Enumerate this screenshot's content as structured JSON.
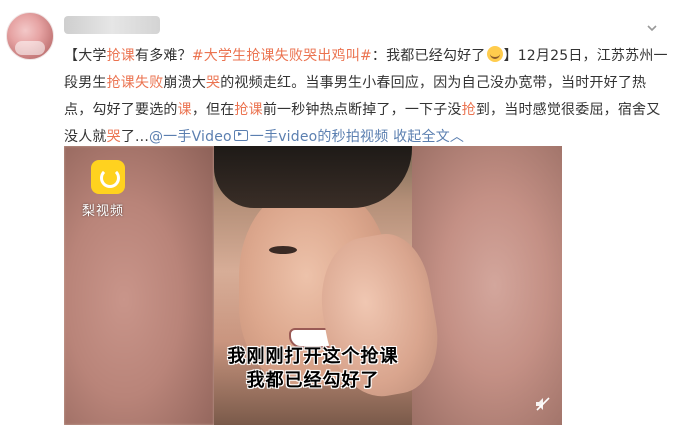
{
  "post": {
    "segments": [
      {
        "text": "【大学",
        "style": "normal"
      },
      {
        "text": "抢课",
        "style": "hl"
      },
      {
        "text": "有多难？",
        "style": "normal"
      },
      {
        "text": "#大学生抢课失败哭出鸡叫#",
        "style": "lk"
      },
      {
        "text": "：我都已经勾好了",
        "style": "normal"
      },
      {
        "text": "",
        "style": "emoji"
      },
      {
        "text": "】12月25日，江苏苏州一段男生",
        "style": "normal"
      },
      {
        "text": "抢课失败",
        "style": "hl"
      },
      {
        "text": "崩溃大",
        "style": "normal"
      },
      {
        "text": "哭",
        "style": "hl"
      },
      {
        "text": "的视频走红。当事男生小春回应，因为自己没办宽带，当时开好了热点，勾好了要选的",
        "style": "normal"
      },
      {
        "text": "课",
        "style": "hl"
      },
      {
        "text": "，但在",
        "style": "normal"
      },
      {
        "text": "抢课",
        "style": "hl"
      },
      {
        "text": "前一秒钟热点断掉了，一下子没",
        "style": "normal"
      },
      {
        "text": "抢",
        "style": "hl"
      },
      {
        "text": "到，当时感觉很委屈，宿舍又没人就",
        "style": "normal"
      },
      {
        "text": "哭",
        "style": "hl"
      },
      {
        "text": "了...",
        "style": "normal"
      },
      {
        "text": "@一手Video",
        "style": "blue"
      },
      {
        "text": "",
        "style": "linkicon"
      },
      {
        "text": "一手video的秒拍视频",
        "style": "blue"
      },
      {
        "text": " ",
        "style": "normal"
      },
      {
        "text": "收起全文",
        "style": "blue"
      },
      {
        "text": "︿",
        "style": "blue"
      }
    ]
  },
  "video": {
    "watermark": "梨视频",
    "subtitle_line1": "我刚刚打开这个抢课",
    "subtitle_line2": "我都已经勾好了"
  },
  "icons": {
    "more": "chevron-down-icon",
    "mute": "mute-icon",
    "emoji": "crying-emoji-icon",
    "link": "video-link-icon"
  },
  "colors": {
    "highlight": "#eb7350",
    "link": "#5b7fb0",
    "text": "#333333",
    "badge": "#ffd21f"
  }
}
